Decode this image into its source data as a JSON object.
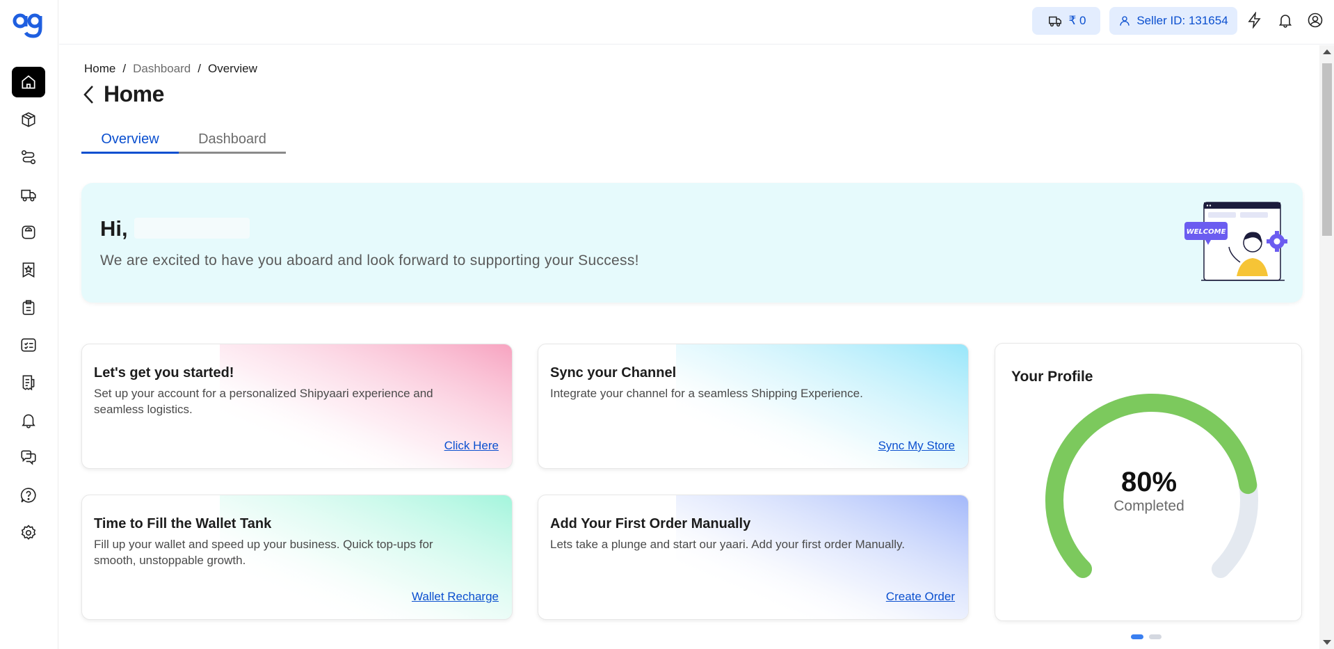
{
  "logo": {
    "text": "ag"
  },
  "sidebar": {
    "items": [
      {
        "icon": "home-icon",
        "active": true
      },
      {
        "icon": "box-icon"
      },
      {
        "icon": "route-icon"
      },
      {
        "icon": "truck-icon"
      },
      {
        "icon": "weight-scale-icon"
      },
      {
        "icon": "badge-star-icon"
      },
      {
        "icon": "clipboard-icon"
      },
      {
        "icon": "checklist-icon"
      },
      {
        "icon": "receipt-icon"
      },
      {
        "icon": "bell-icon"
      },
      {
        "icon": "chat-icon"
      },
      {
        "icon": "help-icon"
      },
      {
        "icon": "settings-icon"
      }
    ]
  },
  "topbar": {
    "wallet_balance": "₹ 0",
    "seller_id": "Seller ID: 131654"
  },
  "breadcrumb": {
    "items": [
      "Home",
      "Dashboard",
      "Overview"
    ],
    "separator": "/"
  },
  "page": {
    "title": "Home",
    "tabs": [
      {
        "label": "Overview",
        "active": true
      },
      {
        "label": "Dashboard",
        "active": false
      }
    ]
  },
  "welcome": {
    "greeting": "Hi,",
    "message": "We are excited to have you aboard and look forward to supporting your Success!",
    "art_text": "WELCOME"
  },
  "cards": [
    {
      "title": "Let's get you started!",
      "description": "Set up your account for a personalized Shipyaari experience and seamless logistics.",
      "link": "Click Here",
      "color": "#f7a8c3"
    },
    {
      "title": "Sync your Channel",
      "description": "Integrate your channel for a seamless Shipping Experience.",
      "link": "Sync My Store",
      "color": "#9ee8f8"
    },
    {
      "title": "Time to Fill the Wallet Tank",
      "description": "Fill up your wallet and speed up your business. Quick top-ups for smooth, unstoppable growth.",
      "link": "Wallet Recharge",
      "color": "#a8f5de"
    },
    {
      "title": "Add Your First Order Manually",
      "description": "Lets take a plunge and start our yaari. Add your first order Manually.",
      "link": "Create Order",
      "color": "#a9bdfb"
    }
  ],
  "profile": {
    "title": "Your Profile",
    "percent": "80%",
    "percent_value": 80,
    "label": "Completed",
    "progress_color": "#7cc95d",
    "track_color": "#e4e9f0"
  },
  "carousel": {
    "pages": 2,
    "active": 0
  }
}
